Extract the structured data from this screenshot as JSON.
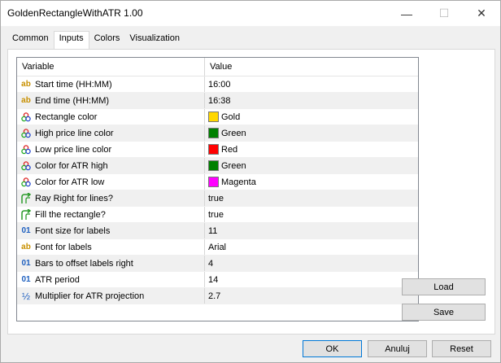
{
  "window": {
    "title": "GoldenRectangleWithATR 1.00"
  },
  "tabs": [
    {
      "label": "Common"
    },
    {
      "label": "Inputs"
    },
    {
      "label": "Colors"
    },
    {
      "label": "Visualization"
    }
  ],
  "grid": {
    "header_variable": "Variable",
    "header_value": "Value",
    "rows": [
      {
        "icon": "ab",
        "variable": "Start time (HH:MM)",
        "value": "16:00"
      },
      {
        "icon": "ab",
        "variable": "End time (HH:MM)",
        "value": "16:38"
      },
      {
        "icon": "color",
        "variable": "Rectangle color",
        "value": "Gold",
        "color": "#FFD700"
      },
      {
        "icon": "color",
        "variable": "High price line color",
        "value": "Green",
        "color": "#008000"
      },
      {
        "icon": "color",
        "variable": "Low price line color",
        "value": "Red",
        "color": "#FF0000"
      },
      {
        "icon": "color",
        "variable": "Color for ATR high",
        "value": "Green",
        "color": "#008000"
      },
      {
        "icon": "color",
        "variable": "Color for ATR low",
        "value": "Magenta",
        "color": "#FF00FF"
      },
      {
        "icon": "bool",
        "variable": "Ray Right for lines?",
        "value": "true"
      },
      {
        "icon": "bool",
        "variable": "Fill the rectangle?",
        "value": "true"
      },
      {
        "icon": "01",
        "variable": "Font size for labels",
        "value": "11"
      },
      {
        "icon": "ab",
        "variable": "Font for labels",
        "value": "Arial"
      },
      {
        "icon": "01",
        "variable": "Bars to offset labels right",
        "value": "4"
      },
      {
        "icon": "01",
        "variable": "ATR period",
        "value": "14"
      },
      {
        "icon": "half",
        "variable": "Multiplier for ATR projection",
        "value": "2.7"
      }
    ]
  },
  "buttons": {
    "load": "Load",
    "save": "Save",
    "ok": "OK",
    "anuluj": "Anuluj",
    "reset": "Reset"
  }
}
